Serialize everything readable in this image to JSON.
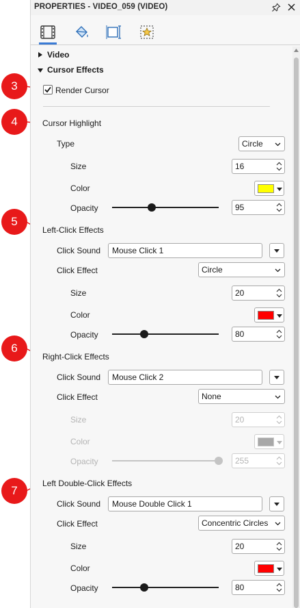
{
  "panel": {
    "title": "PROPERTIES - VIDEO_059 (VIDEO)",
    "pin_icon": "pin-icon",
    "close_icon": "close-icon"
  },
  "tabs": [
    {
      "name": "visual-properties",
      "icon": "filmstrip-icon"
    },
    {
      "name": "fill",
      "icon": "paint-bucket-icon"
    },
    {
      "name": "annotation",
      "icon": "crop-frame-icon"
    },
    {
      "name": "effects",
      "icon": "star-frame-icon"
    }
  ],
  "sections": {
    "video_label": "Video",
    "cursor_effects_label": "Cursor Effects"
  },
  "render_cursor": {
    "label": "Render Cursor",
    "checked": true
  },
  "cursor_highlight": {
    "header": "Cursor Highlight",
    "type_label": "Type",
    "type_value": "Circle",
    "size_label": "Size",
    "size_value": "16",
    "color_label": "Color",
    "color_value": "#ffff00",
    "opacity_label": "Opacity",
    "opacity_value": "95"
  },
  "left_click": {
    "header": "Left-Click Effects",
    "sound_label": "Click Sound",
    "sound_value": "Mouse Click 1",
    "effect_label": "Click Effect",
    "effect_value": "Circle",
    "size_label": "Size",
    "size_value": "20",
    "color_label": "Color",
    "color_value": "#ff0000",
    "opacity_label": "Opacity",
    "opacity_value": "80"
  },
  "right_click": {
    "header": "Right-Click Effects",
    "sound_label": "Click Sound",
    "sound_value": "Mouse Click 2",
    "effect_label": "Click Effect",
    "effect_value": "None",
    "size_label": "Size",
    "size_value": "20",
    "color_label": "Color",
    "color_value": "#a8a8a8",
    "opacity_label": "Opacity",
    "opacity_value": "255"
  },
  "double_click": {
    "header": "Left Double-Click Effects",
    "sound_label": "Click Sound",
    "sound_value": "Mouse Double Click 1",
    "effect_label": "Click Effect",
    "effect_value": "Concentric Circles",
    "size_label": "Size",
    "size_value": "20",
    "color_label": "Color",
    "color_value": "#ff0000",
    "opacity_label": "Opacity",
    "opacity_value": "80"
  },
  "callouts": [
    "3",
    "4",
    "5",
    "6",
    "7"
  ],
  "colors": {
    "callout": "#e8191a",
    "accent": "#3a7bd5"
  }
}
